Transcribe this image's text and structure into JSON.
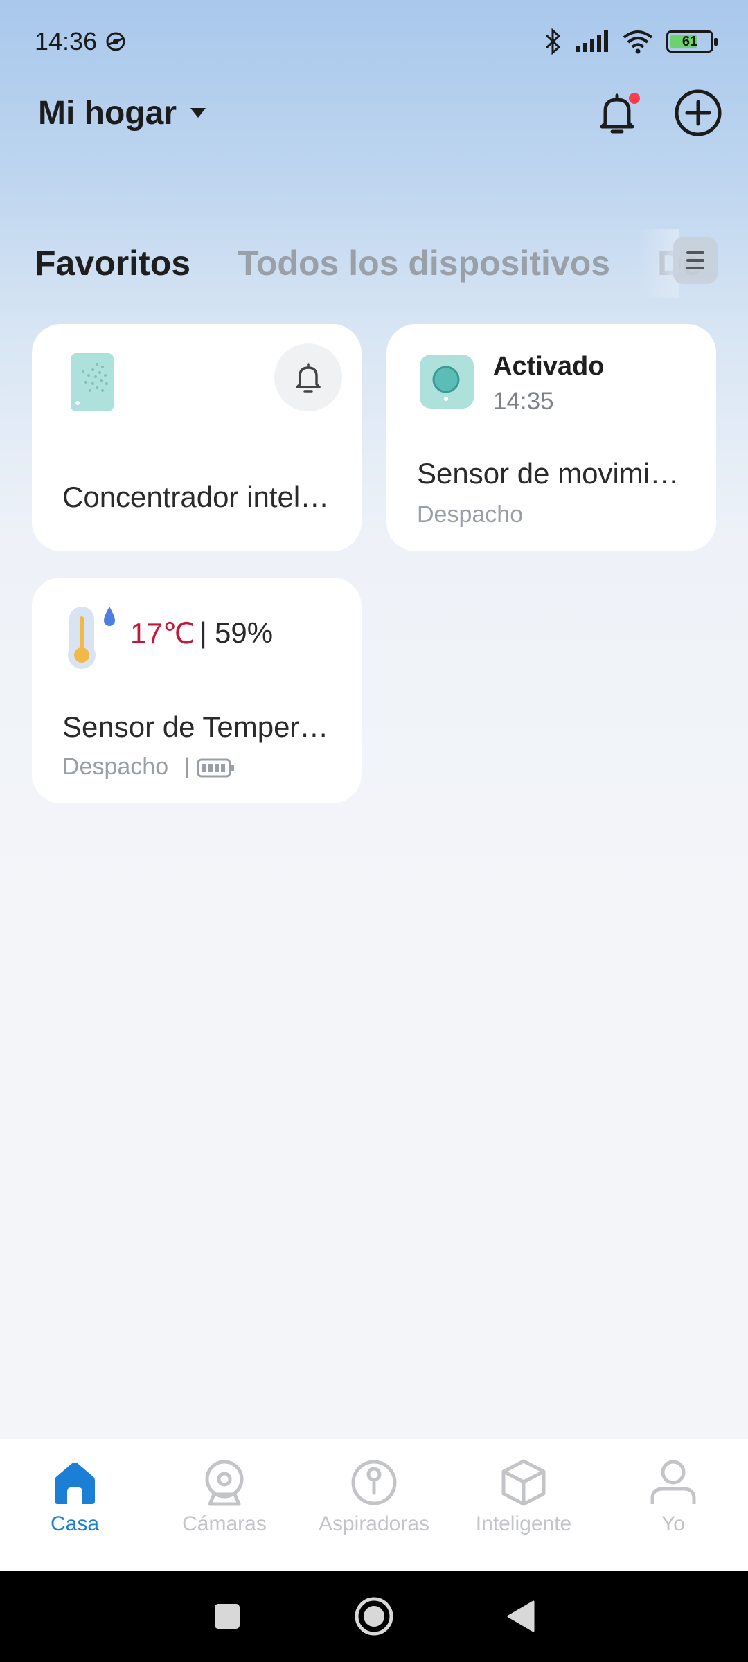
{
  "status_bar": {
    "time": "14:36",
    "battery": "61",
    "icons": [
      "vpn-icon",
      "bluetooth-icon",
      "signal-icon",
      "wifi-icon",
      "battery-icon"
    ]
  },
  "header": {
    "home_name": "Mi hogar"
  },
  "tabs": [
    {
      "label": "Favoritos",
      "active": true
    },
    {
      "label": "Todos los dispositivos",
      "active": false
    },
    {
      "label": "De",
      "active": false
    }
  ],
  "devices": [
    {
      "title": "Concentrador intel…"
    },
    {
      "status": "Activado",
      "time": "14:35",
      "title": "Sensor de movimi…",
      "room": "Despacho"
    },
    {
      "temperature": "17℃",
      "separator": "|",
      "humidity": "59%",
      "title": "Sensor de Temper…",
      "room": "Despacho",
      "divider": "|"
    }
  ],
  "tabbar": [
    {
      "label": "Casa",
      "icon": "home-icon",
      "active": true
    },
    {
      "label": "Cámaras",
      "icon": "camera-icon",
      "active": false
    },
    {
      "label": "Aspiradoras",
      "icon": "vacuum-icon",
      "active": false
    },
    {
      "label": "Inteligente",
      "icon": "cube-icon",
      "active": false
    },
    {
      "label": "Yo",
      "icon": "person-icon",
      "active": false
    }
  ],
  "colors": {
    "accent": "#1b7fd6",
    "temperature": "#c8163a",
    "notification_dot": "#ff3b4e",
    "device_teal": "#aee0dc"
  }
}
